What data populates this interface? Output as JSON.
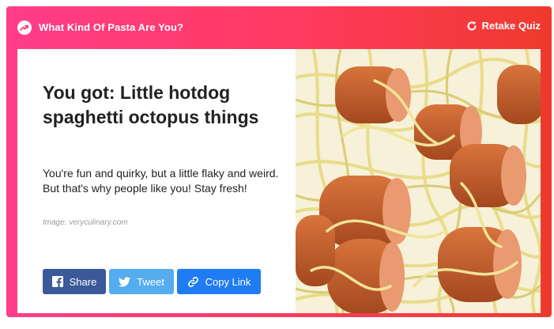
{
  "header": {
    "quiz_title": "What Kind Of Pasta Are You?",
    "retake_label": "Retake Quiz"
  },
  "result": {
    "title": "You got: Little hotdog spaghetti octopus things",
    "description": "You're fun and quirky, but a little flaky and weird. But that's why people like you! Stay fresh!",
    "credit": "Image: veryculinary.com"
  },
  "buttons": {
    "share": "Share",
    "tweet": "Tweet",
    "copy": "Copy Link"
  },
  "colors": {
    "gradient_start": "#ff3d89",
    "gradient_end": "#ee3a2c",
    "facebook": "#3b5998",
    "twitter": "#55acee",
    "copy_link": "#1f7cf2"
  },
  "icons": [
    "trending-icon",
    "retake-icon",
    "facebook-icon",
    "twitter-icon",
    "link-icon"
  ]
}
